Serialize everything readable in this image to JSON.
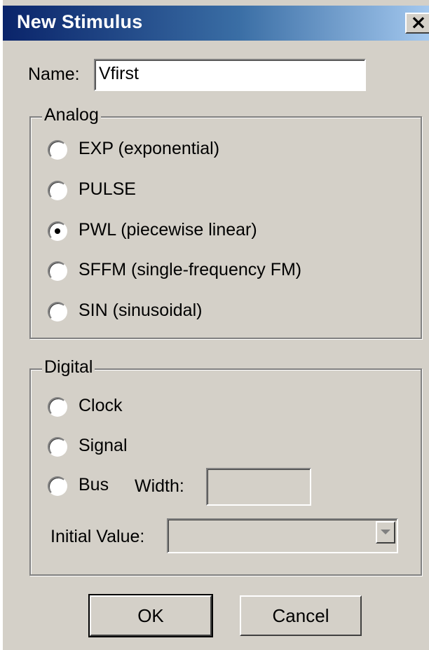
{
  "window": {
    "title": "New Stimulus",
    "close_glyph": "×"
  },
  "name_field": {
    "label": "Name:",
    "value": "Vfirst"
  },
  "analog": {
    "title": "Analog",
    "options": [
      {
        "label": "EXP (exponential)",
        "selected": false
      },
      {
        "label": "PULSE",
        "selected": false
      },
      {
        "label": "PWL (piecewise linear)",
        "selected": true
      },
      {
        "label": "SFFM (single-frequency FM)",
        "selected": false
      },
      {
        "label": "SIN (sinusoidal)",
        "selected": false
      }
    ]
  },
  "digital": {
    "title": "Digital",
    "options": [
      {
        "label": "Clock",
        "selected": false
      },
      {
        "label": "Signal",
        "selected": false
      },
      {
        "label": "Bus",
        "selected": false
      }
    ],
    "width_label": "Width:",
    "width_value": "",
    "initial_value_label": "Initial Value:",
    "initial_value": ""
  },
  "buttons": {
    "ok": "OK",
    "cancel": "Cancel"
  },
  "colors": {
    "dialog_bg": "#d4d0c8",
    "title_start": "#0a246a",
    "title_end": "#a6caf0"
  }
}
